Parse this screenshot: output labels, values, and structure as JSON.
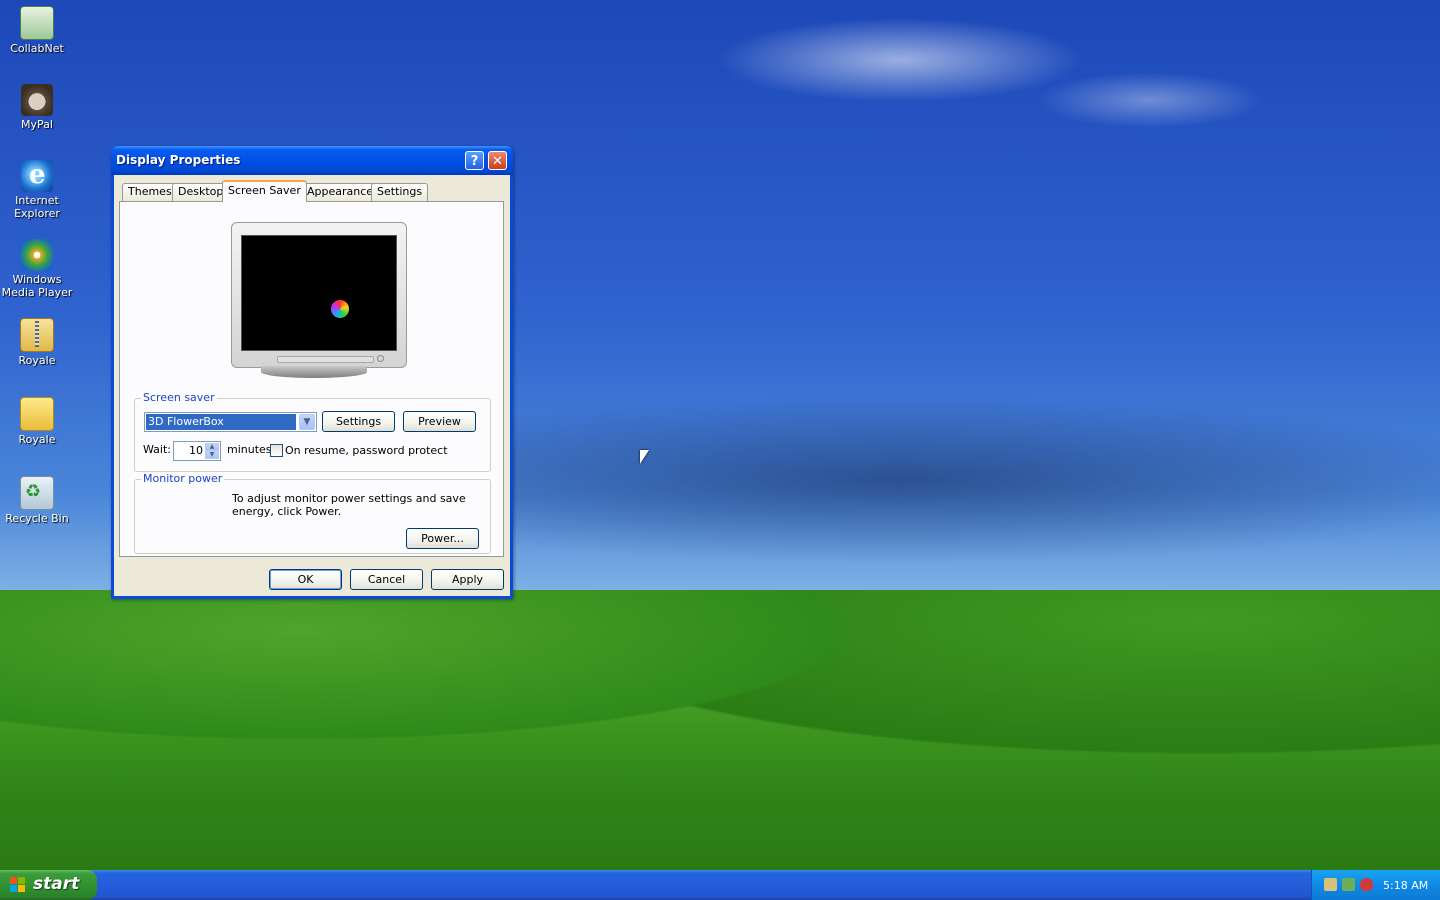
{
  "desktop": {
    "icons": [
      {
        "label": "CollabNet"
      },
      {
        "label": "MyPal"
      },
      {
        "label": "Internet Explorer"
      },
      {
        "label": "Windows Media Player"
      },
      {
        "label": "Royale"
      },
      {
        "label": "Royale"
      },
      {
        "label": "Recycle Bin"
      }
    ]
  },
  "dialog": {
    "title": "Display Properties",
    "help_glyph": "?",
    "close_glyph": "✕",
    "tabs": [
      {
        "label": "Themes"
      },
      {
        "label": "Desktop"
      },
      {
        "label": "Screen Saver",
        "active": true
      },
      {
        "label": "Appearance"
      },
      {
        "label": "Settings"
      }
    ],
    "screen_saver": {
      "group_label": "Screen saver",
      "selected": "3D FlowerBox",
      "settings_button": "Settings",
      "preview_button": "Preview",
      "wait_label": "Wait:",
      "wait_value": "10",
      "minutes_label": "minutes",
      "password_protect_label": "On resume, password protect",
      "password_protect_checked": false
    },
    "monitor_power": {
      "group_label": "Monitor power",
      "description": "To adjust monitor power settings and save energy, click Power.",
      "power_button": "Power..."
    },
    "buttons": {
      "ok": "OK",
      "cancel": "Cancel",
      "apply": "Apply"
    }
  },
  "taskbar": {
    "start_label": "start",
    "clock": "5:18 AM"
  },
  "colors": {
    "titlebar": "#0050e6",
    "dialog_bg": "#ece9d8",
    "selection": "#316ac5",
    "group_label": "#1c44c8",
    "start_button": "#319231",
    "taskbar": "#245edb"
  }
}
